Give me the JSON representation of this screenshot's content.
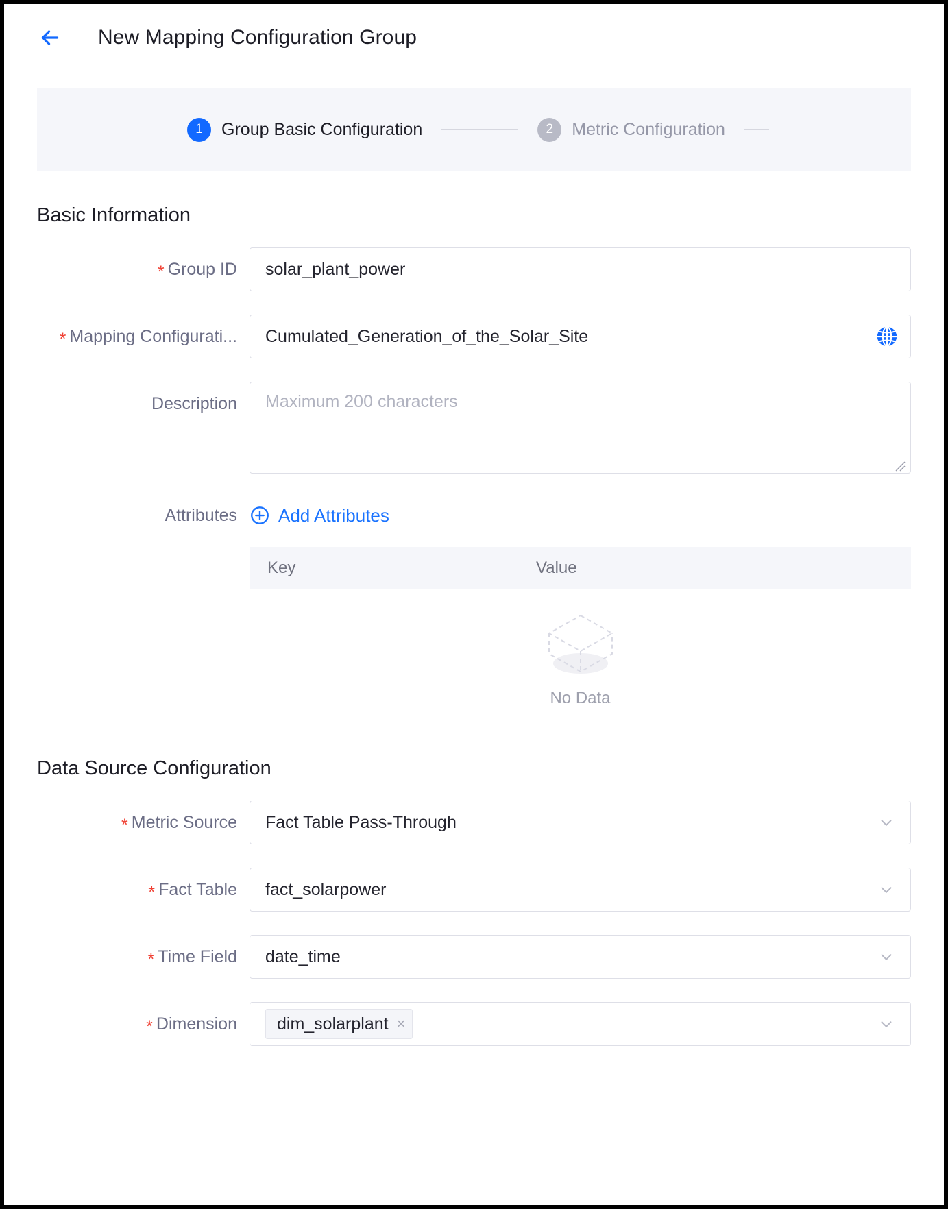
{
  "header": {
    "back_icon": "arrow-left-icon",
    "title": "New Mapping Configuration Group"
  },
  "stepper": {
    "steps": [
      {
        "num": "1",
        "label": "Group Basic Configuration",
        "state": "active"
      },
      {
        "num": "2",
        "label": "Metric Configuration",
        "state": "inactive"
      }
    ]
  },
  "basic_information": {
    "title": "Basic Information",
    "group_id": {
      "label": "Group ID",
      "required": true,
      "value": "solar_plant_power"
    },
    "mapping_configuration": {
      "label": "Mapping Configurati...",
      "required": true,
      "value": "Cumulated_Generation_of_the_Solar_Site",
      "icon": "globe-icon"
    },
    "description": {
      "label": "Description",
      "required": false,
      "value": "",
      "placeholder": "Maximum 200 characters"
    },
    "attributes": {
      "label": "Attributes",
      "add_button": "Add Attributes",
      "add_icon": "plus-circle-icon",
      "columns": [
        "Key",
        "Value",
        ""
      ],
      "rows": [],
      "empty_text": "No Data",
      "empty_icon": "empty-box-icon"
    }
  },
  "data_source_configuration": {
    "title": "Data Source Configuration",
    "fields": [
      {
        "label": "Metric Source",
        "required": true,
        "value": "Fact Table Pass-Through",
        "type": "select"
      },
      {
        "label": "Fact Table",
        "required": true,
        "value": "fact_solarpower",
        "type": "select"
      },
      {
        "label": "Time Field",
        "required": true,
        "value": "date_time",
        "type": "select"
      }
    ],
    "dimension": {
      "label": "Dimension",
      "required": true,
      "tags": [
        "dim_solarplant"
      ],
      "tag_close": "×",
      "type": "multiselect"
    }
  },
  "colors": {
    "accent": "#1269ff",
    "link": "#1a73ff",
    "required_star": "#f04134",
    "label_text": "#6b6d85",
    "step_inactive": "#b8bac6",
    "panel_bg": "#f5f6fa"
  }
}
